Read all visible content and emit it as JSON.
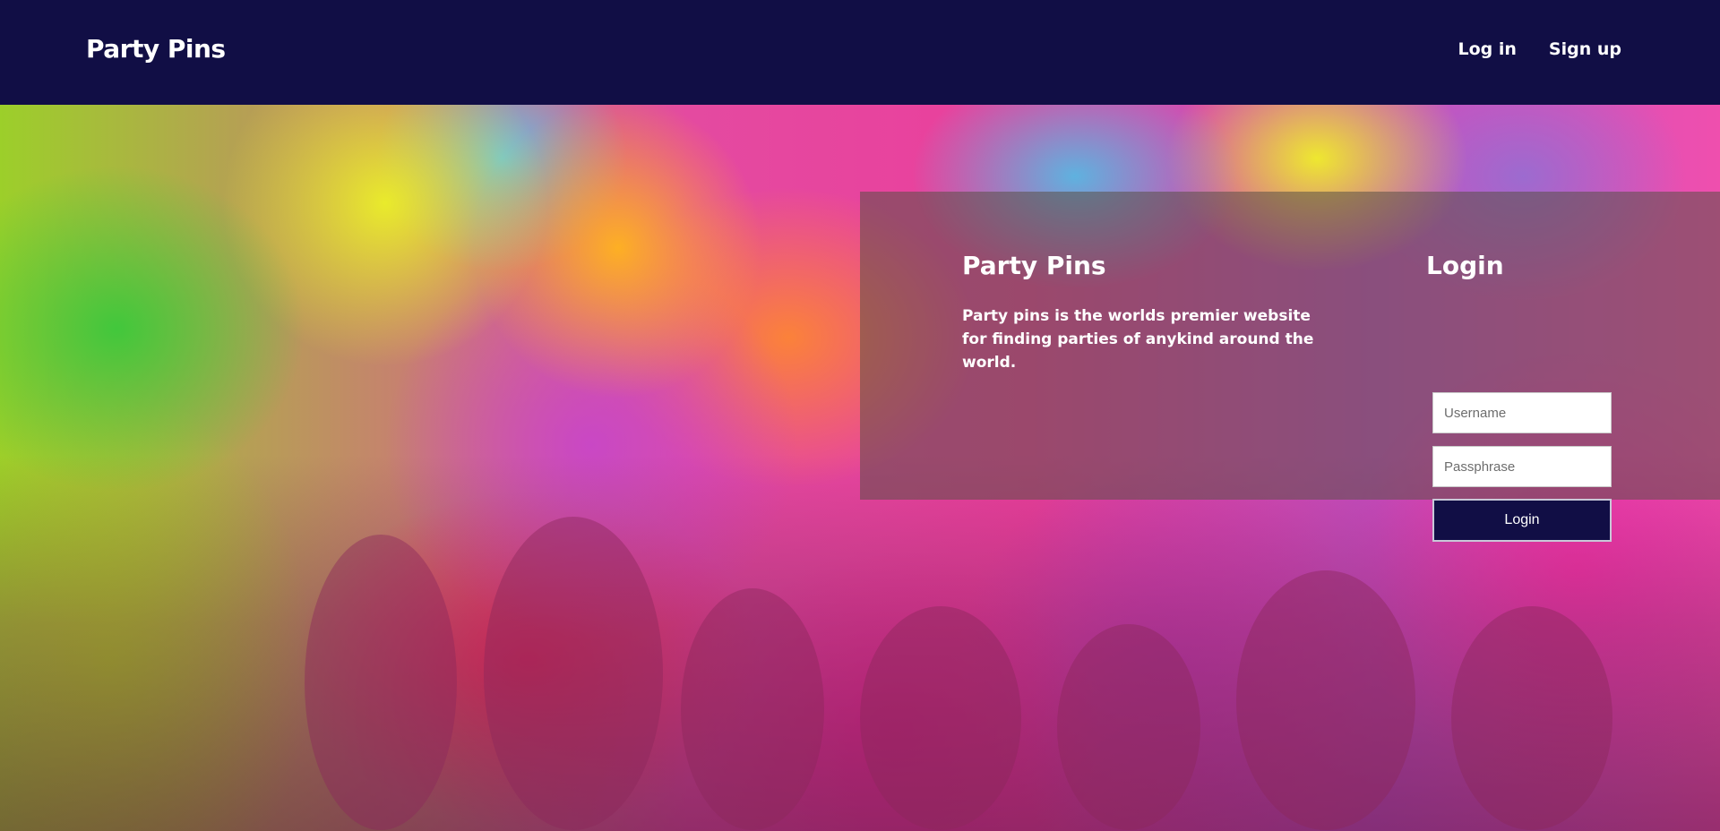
{
  "navbar": {
    "brand": "Party Pins",
    "links": [
      {
        "label": "Log in"
      },
      {
        "label": "Sign up"
      }
    ]
  },
  "hero": {
    "title": "Party Pins",
    "description": "Party pins is the worlds premier website for finding parties of anykind around the world."
  },
  "login": {
    "title": "Login",
    "username_placeholder": "Username",
    "password_placeholder": "Passphrase",
    "button_label": "Login"
  },
  "colors": {
    "navbar_bg": "#110e45",
    "button_bg": "#110e45"
  }
}
